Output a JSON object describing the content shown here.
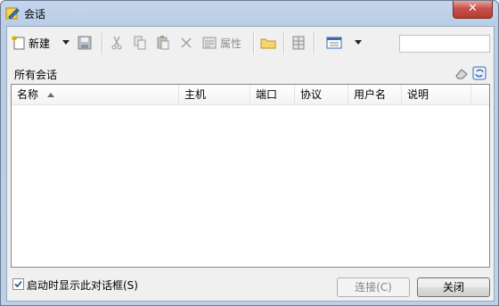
{
  "window": {
    "title": "会话",
    "close_glyph": "✕"
  },
  "toolbar": {
    "new_label": "新建",
    "properties_label": "属性",
    "icons": [
      "new-session-icon",
      "dropdown-arrow-icon",
      "disk-icon",
      "cut-icon",
      "copy-icon",
      "paste-icon",
      "delete-icon",
      "properties-icon",
      "folder-icon",
      "grid-icon",
      "view-icon",
      "dropdown-arrow-icon"
    ]
  },
  "tree": {
    "root_label": "所有会话"
  },
  "table": {
    "columns": [
      "名称",
      "主机",
      "端口",
      "协议",
      "用户名",
      "说明"
    ],
    "rows": []
  },
  "footer": {
    "show_on_startup_label": "启动时显示此对话框(S)",
    "show_on_startup_checked": true,
    "connect_label": "连接(C)",
    "close_label": "关闭"
  },
  "colors": {
    "titlebar": "#bcd0e8",
    "close_button": "#c75050",
    "window_bg": "#f0f0f0"
  }
}
